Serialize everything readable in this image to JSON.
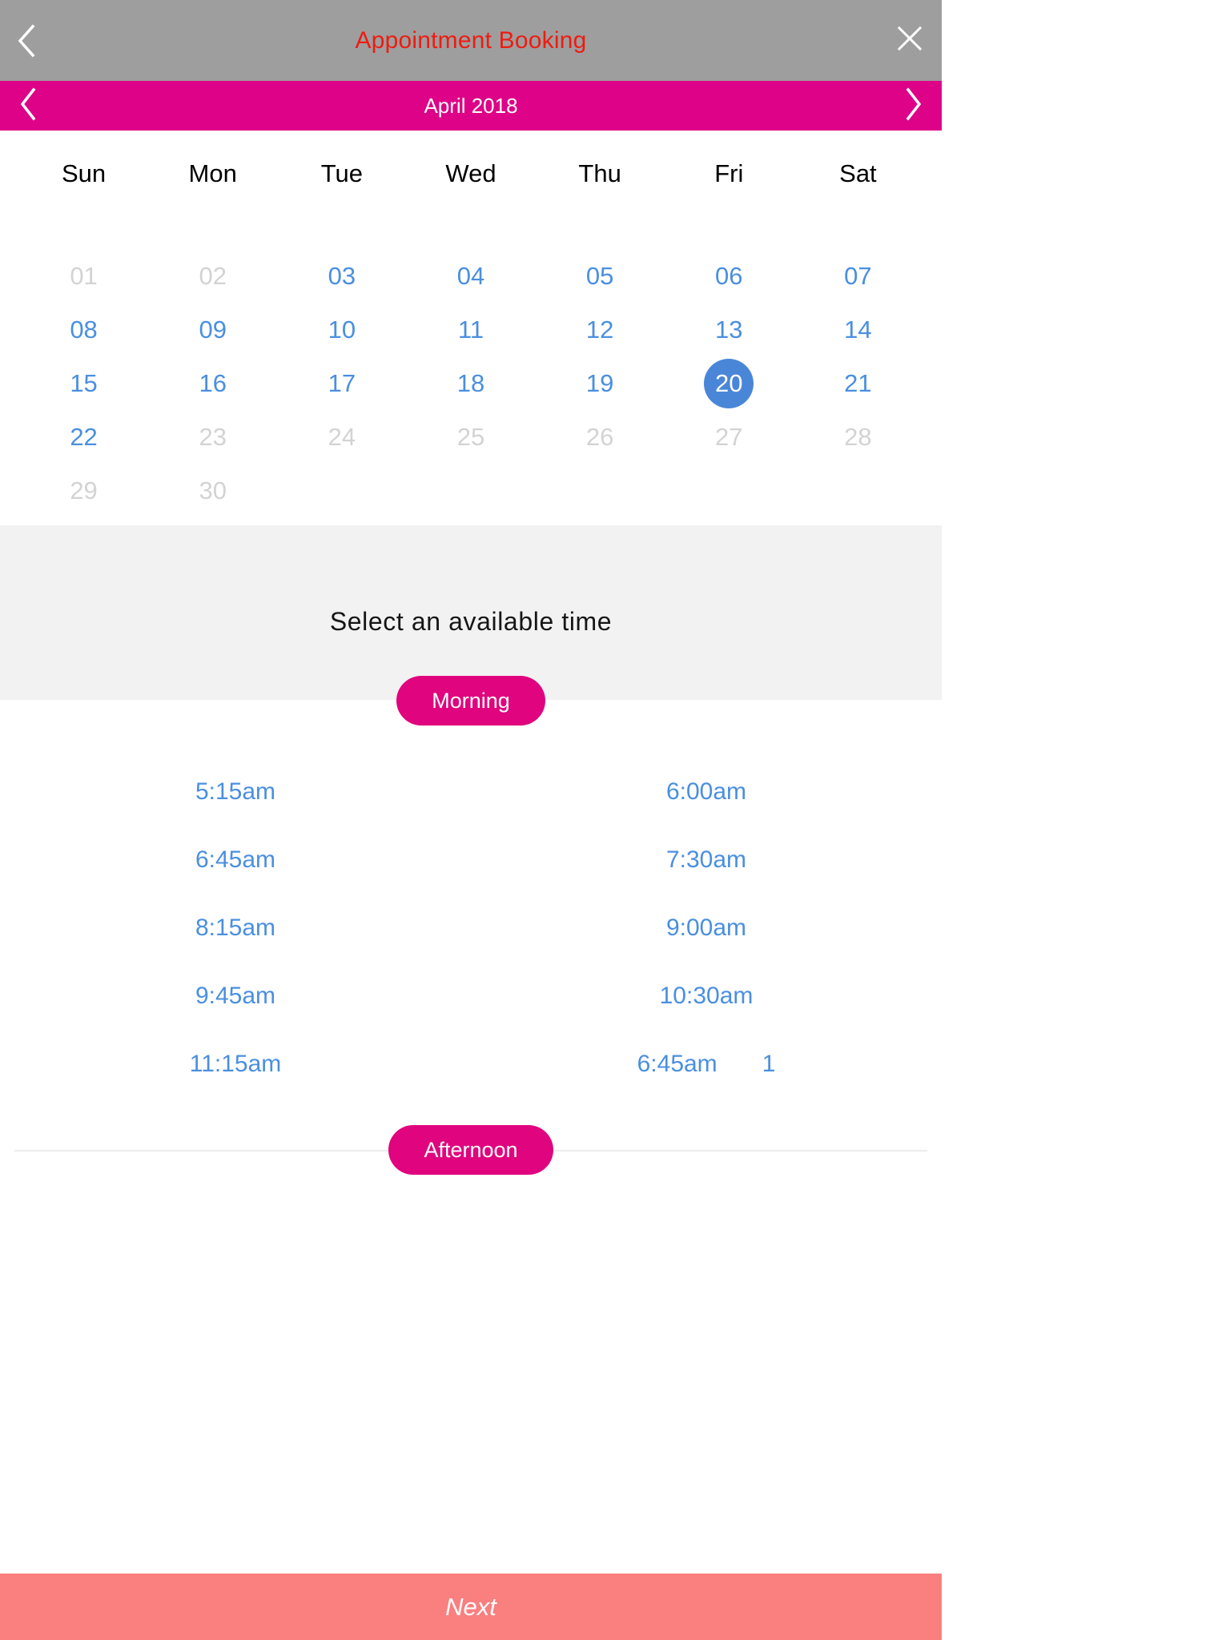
{
  "titlebar": {
    "title": "Appointment Booking",
    "back_icon": "chevron-left-icon",
    "close_icon": "close-icon"
  },
  "month_bar": {
    "label": "April 2018",
    "prev_icon": "chevron-left-icon",
    "next_icon": "chevron-right-icon"
  },
  "calendar": {
    "weekdays": [
      "Sun",
      "Mon",
      "Tue",
      "Wed",
      "Thu",
      "Fri",
      "Sat"
    ],
    "selected_day": "20",
    "accent_selected_color": "#4a86d8",
    "enabled_color": "#4a8fe0",
    "disabled_color": "#d3d3d3",
    "weeks": [
      [
        {
          "label": "01",
          "state": "disabled"
        },
        {
          "label": "02",
          "state": "disabled"
        },
        {
          "label": "03",
          "state": "enabled"
        },
        {
          "label": "04",
          "state": "enabled"
        },
        {
          "label": "05",
          "state": "enabled"
        },
        {
          "label": "06",
          "state": "enabled"
        },
        {
          "label": "07",
          "state": "enabled"
        }
      ],
      [
        {
          "label": "08",
          "state": "enabled"
        },
        {
          "label": "09",
          "state": "enabled"
        },
        {
          "label": "10",
          "state": "enabled"
        },
        {
          "label": "11",
          "state": "enabled"
        },
        {
          "label": "12",
          "state": "enabled"
        },
        {
          "label": "13",
          "state": "enabled"
        },
        {
          "label": "14",
          "state": "enabled"
        }
      ],
      [
        {
          "label": "15",
          "state": "enabled"
        },
        {
          "label": "16",
          "state": "enabled"
        },
        {
          "label": "17",
          "state": "enabled"
        },
        {
          "label": "18",
          "state": "enabled"
        },
        {
          "label": "19",
          "state": "enabled"
        },
        {
          "label": "20",
          "state": "selected"
        },
        {
          "label": "21",
          "state": "enabled"
        }
      ],
      [
        {
          "label": "22",
          "state": "enabled"
        },
        {
          "label": "23",
          "state": "disabled"
        },
        {
          "label": "24",
          "state": "disabled"
        },
        {
          "label": "25",
          "state": "disabled"
        },
        {
          "label": "26",
          "state": "disabled"
        },
        {
          "label": "27",
          "state": "disabled"
        },
        {
          "label": "28",
          "state": "disabled"
        }
      ],
      [
        {
          "label": "29",
          "state": "disabled"
        },
        {
          "label": "30",
          "state": "disabled"
        },
        {
          "label": "",
          "state": "empty"
        },
        {
          "label": "",
          "state": "empty"
        },
        {
          "label": "",
          "state": "empty"
        },
        {
          "label": "",
          "state": "empty"
        },
        {
          "label": "",
          "state": "empty"
        }
      ]
    ]
  },
  "time_section": {
    "heading": "Select an available time",
    "morning_label": "Morning",
    "afternoon_label": "Afternoon",
    "slot_rows": [
      {
        "left": "5:15am",
        "right": "6:00am",
        "extra": null
      },
      {
        "left": "6:45am",
        "right": "7:30am",
        "extra": null
      },
      {
        "left": "8:15am",
        "right": "9:00am",
        "extra": null
      },
      {
        "left": "9:45am",
        "right": "10:30am",
        "extra": null
      },
      {
        "left": "11:15am",
        "right": "6:45am",
        "extra": "1"
      }
    ]
  },
  "footer": {
    "next_label": "Next",
    "next_color": "#fa7f7f"
  }
}
